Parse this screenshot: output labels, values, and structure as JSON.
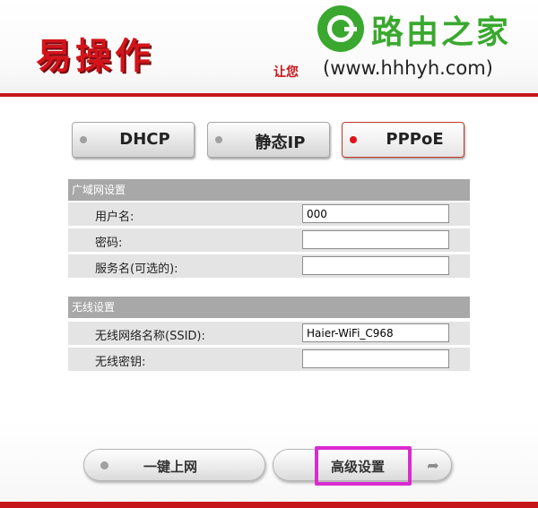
{
  "header": {
    "logo": "易操作",
    "slogan": "让您",
    "watermark_brand": "路由之家",
    "watermark_url": "(www.hhhyh.com)"
  },
  "modes": [
    {
      "label": "DHCP",
      "selected": false
    },
    {
      "label": "静态IP",
      "selected": false
    },
    {
      "label": "PPPoE",
      "selected": true
    }
  ],
  "wan": {
    "title": "广域网设置",
    "fields": [
      {
        "label": "用户名:",
        "value": "000"
      },
      {
        "label": "密码:",
        "value": ""
      },
      {
        "label": "服务名(可选的):",
        "value": ""
      }
    ]
  },
  "wireless": {
    "title": "无线设置",
    "fields": [
      {
        "label": "无线网络名称(SSID):",
        "value": "Haier-WiFi_C968"
      },
      {
        "label": "无线密钥:",
        "value": ""
      }
    ]
  },
  "actions": {
    "connect_label": "一键上网",
    "advanced_label": "高级设置"
  },
  "colors": {
    "brand_red": "#c7161b",
    "watermark_green": "#3aa82f",
    "highlight": "#d92bd0"
  }
}
